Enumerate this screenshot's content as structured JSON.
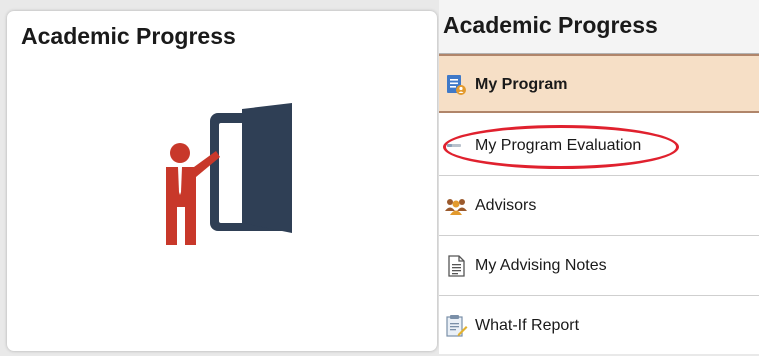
{
  "tile": {
    "title": "Academic Progress",
    "icon": "presenter-door-icon"
  },
  "panel": {
    "title": "Academic Progress",
    "items": [
      {
        "label": "My Program",
        "icon": "program-document-icon",
        "active": true
      },
      {
        "label": "My Program Evaluation",
        "icon": "evaluation-icon",
        "active": false
      },
      {
        "label": "Advisors",
        "icon": "people-icon",
        "active": false
      },
      {
        "label": "My Advising Notes",
        "icon": "notes-icon",
        "active": false
      },
      {
        "label": "What-If Report",
        "icon": "report-icon",
        "active": false
      }
    ]
  },
  "annotation": {
    "highlight_color": "#e0212e"
  },
  "colors": {
    "active_background": "#f6dfc6",
    "active_border": "#b0856a",
    "presenter_red": "#c8382a",
    "door_navy": "#2f3f55"
  }
}
